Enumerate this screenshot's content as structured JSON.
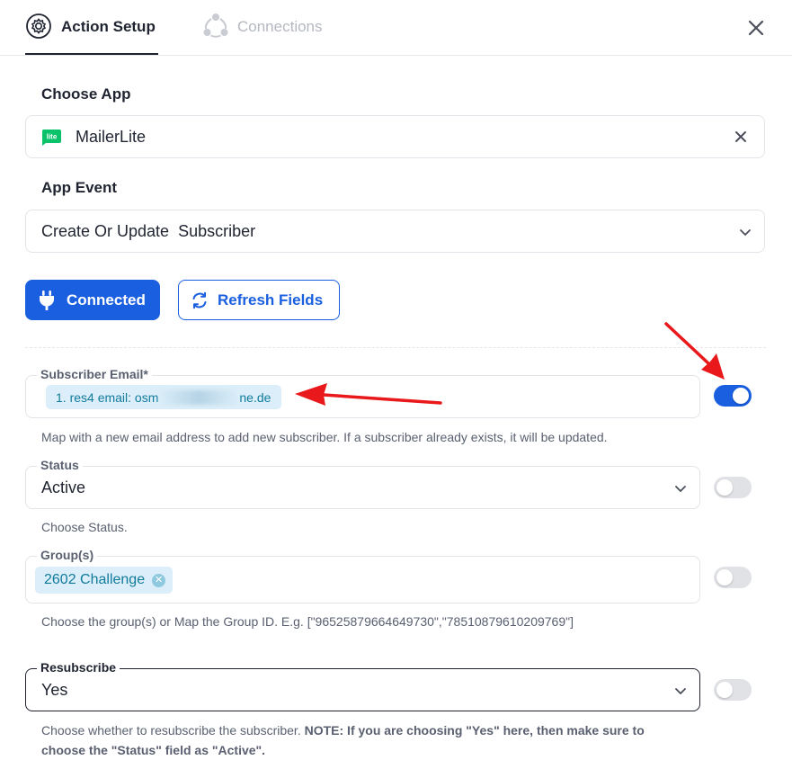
{
  "tabs": [
    {
      "label": "Action Setup",
      "active": true,
      "icon": "gear-icon"
    },
    {
      "label": "Connections",
      "active": false,
      "icon": "connections-icon"
    }
  ],
  "choose_app": {
    "label": "Choose App",
    "value": "MailerLite",
    "logo_text": "lite",
    "logo_color": "#09c269"
  },
  "app_event": {
    "label": "App Event",
    "value": "Create Or Update  Subscriber"
  },
  "buttons": {
    "connected": "Connected",
    "refresh": "Refresh Fields"
  },
  "fields": {
    "subscriber_email": {
      "label": "Subscriber Email",
      "required_mark": "*",
      "chip_prefix": "1. res4 email: osm",
      "chip_suffix": "ne.de",
      "help": "Map with a new email address to add new subscriber. If a subscriber already exists, it will be updated.",
      "toggle_on": true
    },
    "status": {
      "label": "Status",
      "value": "Active",
      "help": "Choose Status.",
      "toggle_on": false
    },
    "groups": {
      "label": "Group(s)",
      "chip": "2602 Challenge",
      "help": "Choose the group(s) or Map the Group ID. E.g. [\"96525879664649730\",\"78510879610209769\"]",
      "toggle_on": false
    },
    "resubscribe": {
      "label": "Resubscribe",
      "value": "Yes",
      "help_plain": "Choose whether to resubscribe the subscriber. ",
      "help_bold": "NOTE: If you are choosing \"Yes\" here, then make sure to choose the \"Status\" field as \"Active\".",
      "toggle_on": false
    }
  },
  "colors": {
    "primary": "#1a5fe0",
    "chip_bg": "#dbeef9",
    "chip_text": "#117b9c",
    "annotation_arrow": "#e8181b"
  }
}
